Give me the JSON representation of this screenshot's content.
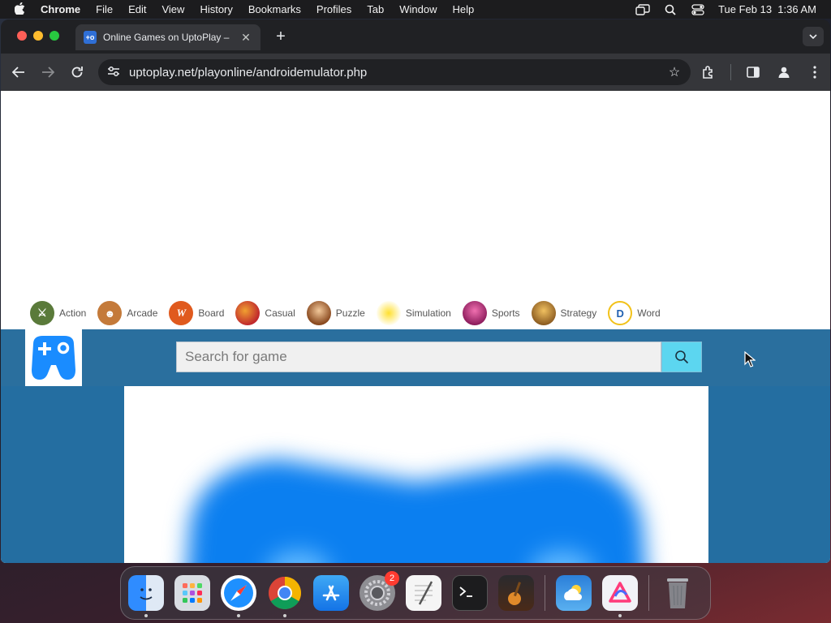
{
  "menubar": {
    "app_name": "Chrome",
    "items": [
      "File",
      "Edit",
      "View",
      "History",
      "Bookmarks",
      "Profiles",
      "Tab",
      "Window",
      "Help"
    ],
    "clock": "Tue Feb 13  1:36 AM"
  },
  "browser": {
    "tab_title": "Online Games on UptoPlay –",
    "url": "uptoplay.net/playonline/androidemulator.php"
  },
  "categories": [
    {
      "label": "Action",
      "color": "#5a7a3a"
    },
    {
      "label": "Arcade",
      "color": "#c47a3a"
    },
    {
      "label": "Board",
      "color": "#e05a1e"
    },
    {
      "label": "Casual",
      "color": "#c0282d"
    },
    {
      "label": "Puzzle",
      "color": "#b8702a"
    },
    {
      "label": "Simulation",
      "color": "#e8c820"
    },
    {
      "label": "Sports",
      "color": "#c83c8c"
    },
    {
      "label": "Strategy",
      "color": "#d09030"
    },
    {
      "label": "Word",
      "color": "#1f5fb0"
    }
  ],
  "search": {
    "placeholder": "Search for game"
  },
  "colors": {
    "header_bg": "#2a6f9e",
    "search_button": "#5cd6f0",
    "logo_blue": "#1a8cff"
  },
  "dock": {
    "items": [
      {
        "name": "finder-icon",
        "running": true
      },
      {
        "name": "launchpad-icon",
        "running": false
      },
      {
        "name": "safari-icon",
        "running": true
      },
      {
        "name": "chrome-icon",
        "running": true
      },
      {
        "name": "app-store-icon",
        "running": false
      },
      {
        "name": "system-settings-icon",
        "running": false,
        "badge": "2"
      },
      {
        "name": "textedit-icon",
        "running": false
      },
      {
        "name": "terminal-icon",
        "running": false
      },
      {
        "name": "garageband-icon",
        "running": false
      },
      {
        "name": "weather-icon",
        "running": false
      },
      {
        "name": "creativity-app-icon",
        "running": true
      },
      {
        "name": "trash-icon",
        "running": false
      }
    ]
  }
}
